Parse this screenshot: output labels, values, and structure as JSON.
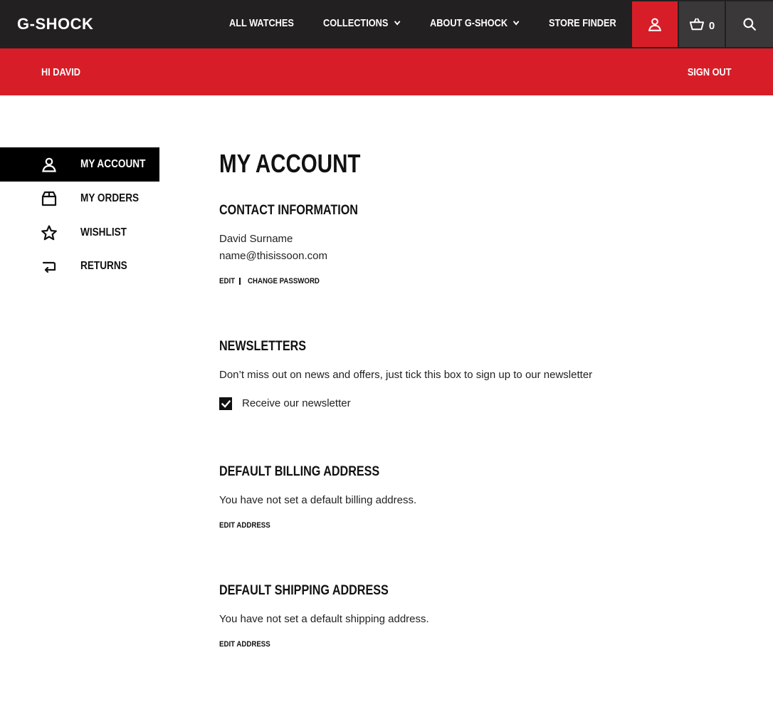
{
  "header": {
    "logo": "G-SHOCK",
    "nav": [
      {
        "label": "ALL WATCHES",
        "has_dropdown": false
      },
      {
        "label": "COLLECTIONS",
        "has_dropdown": true
      },
      {
        "label": "ABOUT G-SHOCK",
        "has_dropdown": true
      },
      {
        "label": "STORE FINDER",
        "has_dropdown": false
      }
    ],
    "icons": {
      "account": "user-icon",
      "cart": "basket-icon",
      "search": "search-icon"
    },
    "cart_count": "0"
  },
  "account_bar": {
    "greeting": "HI DAVID",
    "sign_out": "SIGN OUT"
  },
  "sidebar": {
    "items": [
      {
        "label": "MY ACCOUNT",
        "icon": "user-icon",
        "active": true
      },
      {
        "label": "MY ORDERS",
        "icon": "box-icon",
        "active": false
      },
      {
        "label": "WISHLIST",
        "icon": "star-icon",
        "active": false
      },
      {
        "label": "RETURNS",
        "icon": "return-arrow-icon",
        "active": false
      }
    ]
  },
  "main": {
    "title": "MY ACCOUNT",
    "contact": {
      "heading": "CONTACT INFORMATION",
      "name": "David Surname",
      "email": "name@thisissoon.com",
      "edit": "EDIT",
      "change_password": "CHANGE PASSWORD"
    },
    "newsletters": {
      "heading": "NEWSLETTERS",
      "description": "Don’t miss out on news and offers, just tick this box to sign up to our newsletter",
      "checkbox_label": "Receive our newsletter",
      "checked": true
    },
    "billing": {
      "heading": "DEFAULT BILLING ADDRESS",
      "text": "You have not set a default billing address.",
      "edit": "EDIT ADDRESS"
    },
    "shipping": {
      "heading": "DEFAULT SHIPPING ADDRESS",
      "text": "You have not set a default shipping address.",
      "edit": "EDIT ADDRESS"
    }
  },
  "colors": {
    "brand_red": "#d71e28",
    "nav_dark": "#222020",
    "icon_box": "#3a3838"
  }
}
